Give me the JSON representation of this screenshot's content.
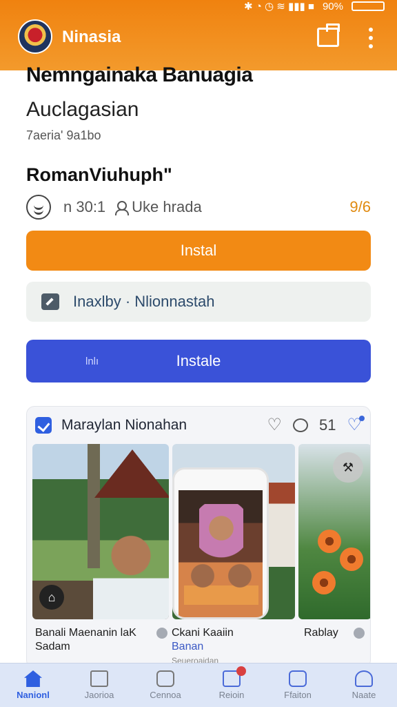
{
  "status": {
    "signal_text": "90%"
  },
  "app": {
    "title": "Ninasia"
  },
  "header": {
    "title": "Nemngainaka Banuagia",
    "subtitle": "Auclagasian",
    "meta": "7aeria' 9a1bo",
    "section_title": "RomanViuhuph\""
  },
  "info": {
    "count": "n 30:1",
    "user": "Uke hrada",
    "rating": "9/6"
  },
  "buttons": {
    "install": "Instal",
    "secondary": "Inaxlby · Nlionnastah",
    "blue_small": "lnlı",
    "blue": "Instale"
  },
  "card": {
    "title": "Maraylan Nionahan",
    "count": "51",
    "captions": [
      {
        "line1": "Banali Maenanin laK",
        "line2": "Sadam"
      },
      {
        "line1": "Ckani Kaaiin",
        "line2": "Banan",
        "line3": "Seueroaidan"
      },
      {
        "line1": "Rablay"
      }
    ]
  },
  "nav": {
    "items": [
      {
        "label": "Nanionl",
        "icon": "home-icon"
      },
      {
        "label": "Jaorioa",
        "icon": "book-icon"
      },
      {
        "label": "Cennoa",
        "icon": "hexagon-icon"
      },
      {
        "label": "Reioin",
        "icon": "star-icon"
      },
      {
        "label": "Ffaiton",
        "icon": "face-icon"
      },
      {
        "label": "Naate",
        "icon": "user-icon"
      }
    ]
  },
  "colors": {
    "accent": "#f28a14",
    "primary": "#3a52d8",
    "active_nav": "#2f5fe0"
  }
}
